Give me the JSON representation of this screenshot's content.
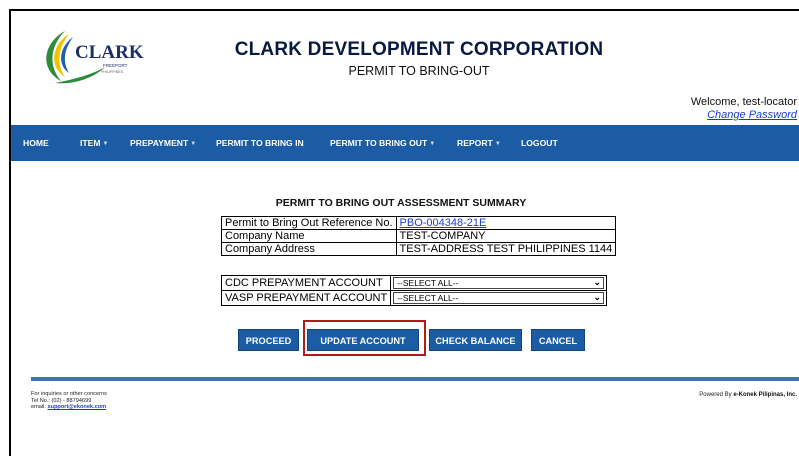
{
  "header": {
    "logo_text": "CLARK",
    "logo_subtext": "FREEPORT",
    "logo_subtext2": "PHILIPPINES",
    "title": "CLARK DEVELOPMENT CORPORATION",
    "subtitle": "PERMIT TO BRING-OUT",
    "welcome": "Welcome, test-locator",
    "change_password": "Change Password"
  },
  "nav": {
    "items": [
      {
        "label": "HOME"
      },
      {
        "label": "ITEM"
      },
      {
        "label": "PREPAYMENT"
      },
      {
        "label": "PERMIT TO BRING IN"
      },
      {
        "label": "PERMIT TO BRING OUT"
      },
      {
        "label": "REPORT"
      },
      {
        "label": "LOGOUT"
      }
    ]
  },
  "summary": {
    "title": "PERMIT TO BRING OUT ASSESSMENT SUMMARY",
    "rows": [
      {
        "label": "Permit to Bring Out Reference No.",
        "value": "PBO-004348-21E"
      },
      {
        "label": "Company Name",
        "value": "TEST-COMPANY"
      },
      {
        "label": "Company Address",
        "value": "TEST-ADDRESS TEST PHILIPPINES 1144"
      }
    ]
  },
  "accounts": [
    {
      "label": "CDC PREPAYMENT ACCOUNT",
      "selected": "--SELECT ALL--"
    },
    {
      "label": "VASP PREPAYMENT ACCOUNT",
      "selected": "--SELECT ALL--"
    }
  ],
  "buttons": {
    "proceed": "PROCEED",
    "update_account": "UPDATE ACCOUNT",
    "check_balance": "CHECK BALANCE",
    "cancel": "CANCEL"
  },
  "footer": {
    "line1": "For inquiries or other concerns",
    "line2": "Tel No.: (02) - 88794699",
    "email_label": "email:",
    "email": "support@ekonek.com",
    "powered_by": "Powered By",
    "company": "e-Konek Pilipinas, Inc."
  },
  "colors": {
    "navbar": "#1c5ca4",
    "button": "#1c5ca4",
    "highlight": "#b01b1b",
    "link": "#1a3ecc"
  }
}
